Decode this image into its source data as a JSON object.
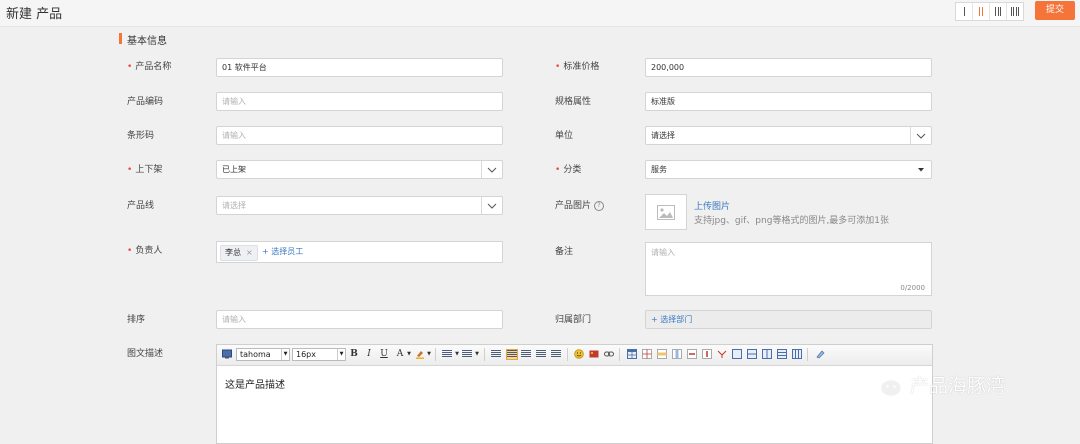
{
  "header": {
    "title": "新建 产品",
    "layout_options": [
      "I",
      "II",
      "III",
      "IIII"
    ],
    "active_layout": 1,
    "submit_label": "提交"
  },
  "section": {
    "title": "基本信息"
  },
  "form": {
    "product_name": {
      "label": "产品名称",
      "required": true,
      "value": "01 软件平台"
    },
    "product_code": {
      "label": "产品编码",
      "placeholder": "请输入"
    },
    "barcode": {
      "label": "条形码",
      "placeholder": "请输入"
    },
    "on_shelf": {
      "label": "上下架",
      "required": true,
      "value": "已上架"
    },
    "product_line": {
      "label": "产品线",
      "placeholder": "请选择"
    },
    "owner": {
      "label": "负责人",
      "required": true,
      "tag": "李总",
      "tag_remove": "×",
      "choose_label": "+ 选择员工"
    },
    "sort": {
      "label": "排序",
      "placeholder": "请输入"
    },
    "description": {
      "label": "图文描述",
      "content": "这是产品描述"
    },
    "price": {
      "label": "标准价格",
      "required": true,
      "value": "200,000"
    },
    "spec": {
      "label": "规格属性",
      "value": "标准版"
    },
    "unit": {
      "label": "单位",
      "value": "请选择"
    },
    "category": {
      "label": "分类",
      "required": true,
      "value": "服务"
    },
    "image": {
      "label": "产品图片",
      "help": "?",
      "upload_label": "上传图片",
      "hint": "支持jpg、gif、png等格式的图片,最多可添加1张"
    },
    "remark": {
      "label": "备注",
      "placeholder": "请输入",
      "counter": "0/2000"
    },
    "department": {
      "label": "归属部门",
      "choose_label": "+ 选择部门"
    }
  },
  "editor": {
    "font_family": "tahoma",
    "font_size": "16px",
    "bold": "B",
    "italic": "I",
    "underline": "U",
    "font_color": "A"
  },
  "watermark": {
    "text": "产品海豚湾"
  },
  "colors": {
    "accent": "#f5743a",
    "link": "#3a78c3",
    "required": "#e84c3d"
  }
}
